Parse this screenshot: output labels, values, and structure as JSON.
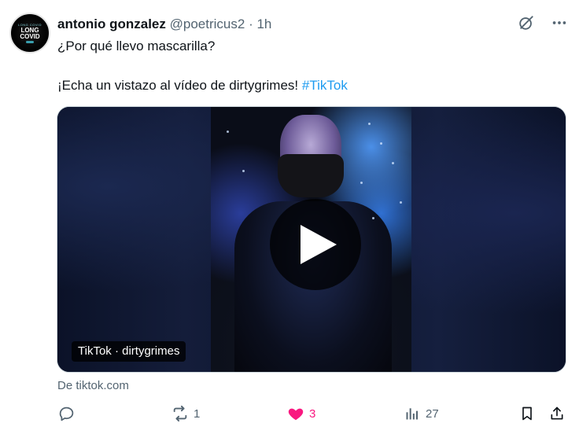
{
  "tweet": {
    "author_name": "antonio gonzalez",
    "handle": "@poetricus2",
    "separator": "·",
    "time": "1h",
    "avatar": {
      "top_text": "LONG COVID",
      "line1": "LONG",
      "line2": "COVID"
    },
    "text_line1": "¿Por qué llevo mascarilla?",
    "text_line2_prefix": "¡Echa un vistazo al vídeo de dirtygrimes! ",
    "hashtag": "#TikTok",
    "media_badge": "TikTok · dirtygrimes",
    "source": "De tiktok.com",
    "stats": {
      "replies": "",
      "reposts": "1",
      "likes": "3",
      "views": "27"
    },
    "colors": {
      "accent": "#1d9bf0",
      "like": "#f91880",
      "muted": "#536471"
    }
  },
  "icons": {
    "top": [
      "grok-icon",
      "more-icon"
    ],
    "actions": [
      "reply-icon",
      "repost-icon",
      "heart-icon",
      "views-icon",
      "bookmark-icon",
      "share-icon"
    ]
  }
}
